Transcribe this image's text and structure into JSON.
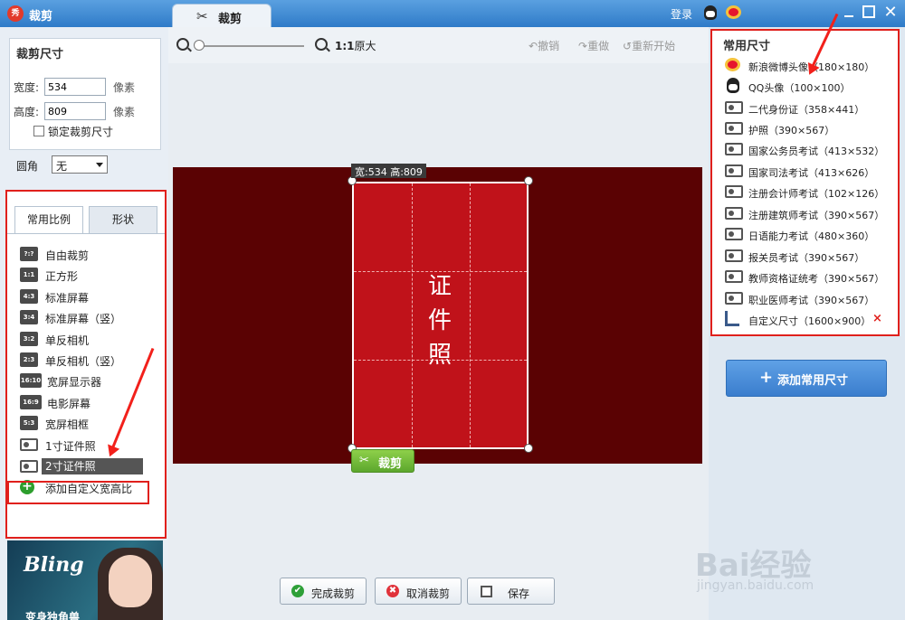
{
  "window": {
    "title": "裁剪",
    "logo_text": "秀",
    "tab_label": "裁剪",
    "login": "登录",
    "close_glyph": "✕"
  },
  "crop_size": {
    "title": "裁剪尺寸",
    "width_label": "宽度:",
    "width_value": "534",
    "height_label": "高度:",
    "height_value": "809",
    "unit": "像素",
    "lock_label": "锁定裁剪尺寸",
    "lock_checked": false,
    "radius_label": "圆角",
    "radius_value": "无"
  },
  "ratio_panel": {
    "tabs": [
      "常用比例",
      "形状"
    ],
    "active_tab": "常用比例",
    "items": [
      {
        "badge": "?:?",
        "label": "自由裁剪"
      },
      {
        "badge": "1:1",
        "label": "正方形"
      },
      {
        "badge": "4:3",
        "label": "标准屏幕"
      },
      {
        "badge": "3:4",
        "label": "标准屏幕（竖）"
      },
      {
        "badge": "3:2",
        "label": "单反相机"
      },
      {
        "badge": "2:3",
        "label": "单反相机（竖）"
      },
      {
        "badge": "16:10",
        "label": "宽屏显示器"
      },
      {
        "badge": "16:9",
        "label": "电影屏幕"
      },
      {
        "badge": "5:3",
        "label": "宽屏相框"
      },
      {
        "badge": "",
        "label": "1寸证件照"
      },
      {
        "badge": "",
        "label": "2寸证件照"
      },
      {
        "badge": "+",
        "label": "添加自定义宽高比"
      }
    ],
    "selected": "2寸证件照"
  },
  "ad": {
    "title": "Bling",
    "subtitle": "变身独角兽"
  },
  "toolbar": {
    "ratio": "1:1",
    "original": "原大",
    "undo": "撤销",
    "redo": "重做",
    "restart": "重新开始"
  },
  "canvas": {
    "size_tip": "宽:534 高:809",
    "photo_text": "证件照",
    "crop_button": "裁剪",
    "scissors_glyph": "✂",
    "photo_color": "#c0121a",
    "background_color": "#5a0203"
  },
  "footer": {
    "finish": "完成裁剪",
    "cancel": "取消裁剪",
    "save": "保存"
  },
  "common_sizes": {
    "title": "常用尺寸",
    "items": [
      {
        "icon": "weibo",
        "label": "新浪微博头像（180×180）"
      },
      {
        "icon": "qq",
        "label": "QQ头像（100×100）"
      },
      {
        "icon": "id",
        "label": "二代身份证（358×441）"
      },
      {
        "icon": "id",
        "label": "护照（390×567）"
      },
      {
        "icon": "id",
        "label": "国家公务员考试（413×532）"
      },
      {
        "icon": "id",
        "label": "国家司法考试（413×626）"
      },
      {
        "icon": "id",
        "label": "注册会计师考试（102×126）"
      },
      {
        "icon": "id",
        "label": "注册建筑师考试（390×567）"
      },
      {
        "icon": "id",
        "label": "日语能力考试（480×360）"
      },
      {
        "icon": "id",
        "label": "报关员考试（390×567）"
      },
      {
        "icon": "id",
        "label": "教师资格证统考（390×567）"
      },
      {
        "icon": "id",
        "label": "职业医师考试（390×567）"
      },
      {
        "icon": "ruler",
        "label": "自定义尺寸（1600×900）"
      }
    ],
    "delete_glyph": "×",
    "add_button": "添加常用尺寸"
  },
  "watermark": {
    "main": "Bai经验",
    "sub": "jingyan.baidu.com"
  }
}
